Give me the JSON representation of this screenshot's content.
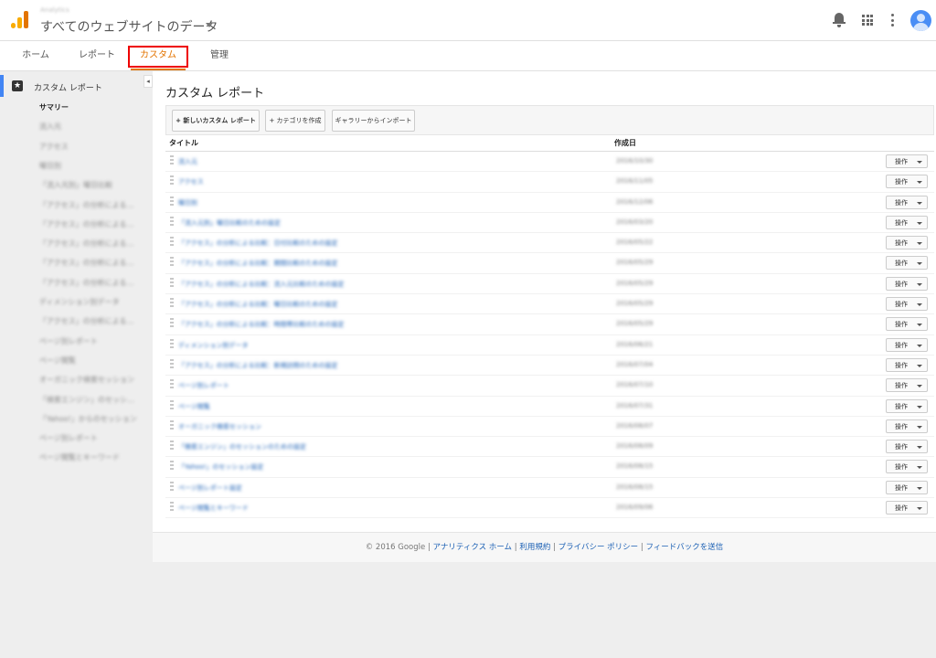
{
  "header": {
    "crumb": "Analytics",
    "property": "すべてのウェブサイトのデータ"
  },
  "nav": {
    "tabs": [
      "ホーム",
      "レポート",
      "カスタム",
      "管理"
    ],
    "active": "カスタム"
  },
  "sidebar": {
    "section_label": "カスタム レポート",
    "items": [
      "サマリー",
      "流入元",
      "アクセス",
      "曜日別",
      "「流入元別」曜日比較",
      "「アクセス」の分析による…",
      "「アクセス」の分析による…",
      "「アクセス」の分析による…",
      "「アクセス」の分析による…",
      "「アクセス」の分析による…",
      "ディメンション別データ",
      "「アクセス」の分析による…",
      "ページ別レポート",
      "ページ閲覧",
      "オーガニック検索セッション",
      "「検索エンジン」のセッシ…",
      "「Yahoo!」からのセッション",
      "ページ別レポート",
      "ページ閲覧とキーワード"
    ]
  },
  "main": {
    "title": "カスタム レポート",
    "buttons": {
      "new": "+ 新しいカスタム レポート",
      "category": "+ カテゴリを作成",
      "gallery": "ギャラリーからインポート"
    },
    "columns": {
      "title": "タイトル",
      "created": "作成日"
    },
    "rows": [
      {
        "title": "流入元",
        "date": "2016/10/30"
      },
      {
        "title": "アクセス",
        "date": "2016/11/05"
      },
      {
        "title": "曜日別",
        "date": "2016/12/06"
      },
      {
        "title": "「流入元別」曜日比較のための設定",
        "date": "2016/03/20"
      },
      {
        "title": "「アクセス」の分析による比較：日付比較のための設定",
        "date": "2016/05/22"
      },
      {
        "title": "「アクセス」の分析による比較：期間比較のための設定",
        "date": "2016/05/29"
      },
      {
        "title": "「アクセス」の分析による比較：流入元比較のための設定",
        "date": "2016/05/29"
      },
      {
        "title": "「アクセス」の分析による比較：曜日比較のための設定",
        "date": "2016/05/29"
      },
      {
        "title": "「アクセス」の分析による比較：時間帯比較のための設定",
        "date": "2016/05/29"
      },
      {
        "title": "ディメンション別データ",
        "date": "2016/06/21"
      },
      {
        "title": "「アクセス」の分析による比較：新規訪問のための設定",
        "date": "2016/07/04"
      },
      {
        "title": "ページ別レポート",
        "date": "2016/07/10"
      },
      {
        "title": "ページ閲覧",
        "date": "2016/07/31"
      },
      {
        "title": "オーガニック検索セッション",
        "date": "2016/08/07"
      },
      {
        "title": "「検索エンジン」のセッションのための設定",
        "date": "2016/08/09"
      },
      {
        "title": "「Yahoo!」のセッション設定",
        "date": "2016/08/15"
      },
      {
        "title": "ページ別レポート設定",
        "date": "2016/08/15"
      },
      {
        "title": "ページ閲覧とキーワード",
        "date": "2016/09/06"
      }
    ],
    "op_label": "操作"
  },
  "footer": {
    "copyright": "© 2016 Google",
    "links": [
      "アナリティクス ホーム",
      "利用規約",
      "プライバシー ポリシー",
      "フィードバックを送信"
    ],
    "separator": "|"
  },
  "colors": {
    "accent": "#e37400",
    "link": "#1a5fb4",
    "highlight_box": "#ee0000",
    "sidebar_bar": "#4285f4"
  },
  "icons": [
    "analytics-logo-icon",
    "bell-icon",
    "apps-grid-icon",
    "more-vert-icon",
    "avatar-icon",
    "star-icon",
    "collapse-icon",
    "drag-handle-icon",
    "caret-down-icon"
  ]
}
